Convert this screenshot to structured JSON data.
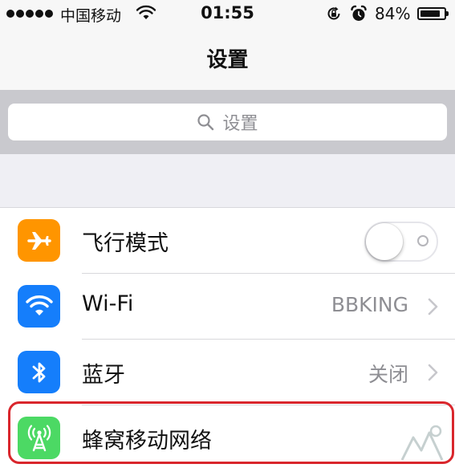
{
  "status_bar": {
    "carrier": "中国移动",
    "time": "01:55",
    "battery_percent": "84%",
    "battery_level": 0.84
  },
  "nav": {
    "title": "设置"
  },
  "search": {
    "placeholder": "设置"
  },
  "settings": [
    {
      "label": "飞行模式",
      "icon": "airplane-icon",
      "icon_color": "#ff9500",
      "toggle_on": false
    },
    {
      "label": "Wi-Fi",
      "icon": "wifi-icon",
      "icon_color": "#157efb",
      "value": "BBKING"
    },
    {
      "label": "蓝牙",
      "icon": "bluetooth-icon",
      "icon_color": "#157efb",
      "value": "关闭"
    },
    {
      "label": "蜂窝移动网络",
      "icon": "cellular-antenna-icon",
      "icon_color": "#4cd964"
    }
  ],
  "colors": {
    "highlight": "#d9262c",
    "secondary_text": "#8e8e93"
  }
}
